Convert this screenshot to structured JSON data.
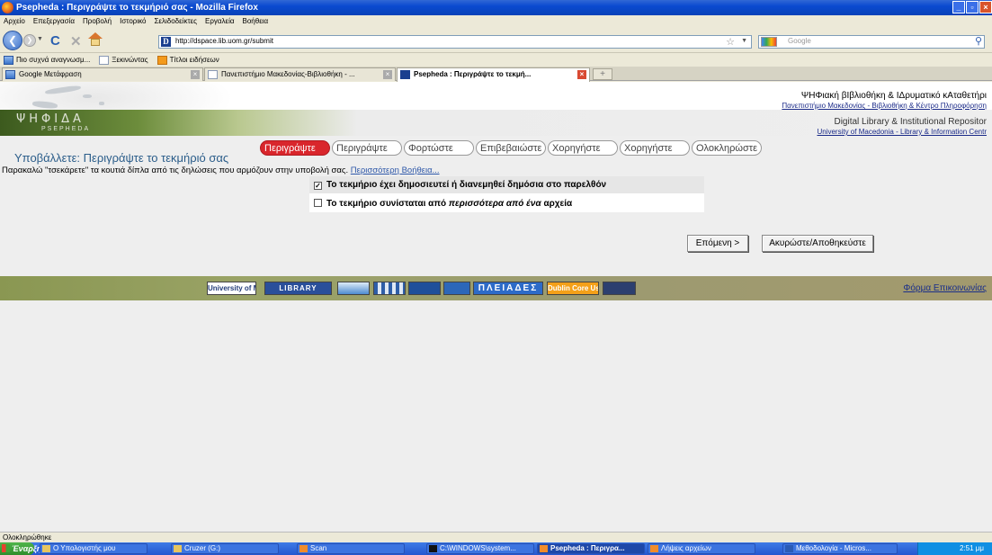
{
  "window": {
    "title": "Psepheda : Περιγράψτε το τεκμήριό σας - Mozilla Firefox",
    "controls": [
      "_",
      "▫",
      "×"
    ]
  },
  "menubar": [
    "Αρχείο",
    "Επεξεργασία",
    "Προβολή",
    "Ιστορικό",
    "Σελιδοδείκτες",
    "Εργαλεία",
    "Βοήθεια"
  ],
  "navbar": {
    "url": "http://dspace.lib.uom.gr/submit",
    "search_placeholder": "Google"
  },
  "bookmarks": [
    "Πιο συχνά αναγνωσμ...",
    "Ξεκινώντας",
    "Τίτλοι ειδήσεων"
  ],
  "tabs": [
    {
      "label": "Google Μετάφραση"
    },
    {
      "label": "Πανεπιστήμιο Μακεδονίας-Βιβλιοθήκη - ..."
    },
    {
      "label": "Psepheda : Περιγράψτε το τεκμή..."
    }
  ],
  "header": {
    "site_title": "ΨΗΦιακή βΙβλιοθήκη & ΙΔρυματικό κΑταθετήρι",
    "site_subtitle": "Πανεπιστήμιο Μακεδονίας - Βιβλιοθήκη & Κέντρο Πληροφόρηση",
    "logo_word": "ΨΗΦΙΔΑ",
    "logo_sub": "PSEPHEDA",
    "dl_title": "Digital Library & Institutional Repositor",
    "dl_subtitle": "University of Macedonia - Library & Information Centr"
  },
  "steps": [
    {
      "label": "Περιγράψτε",
      "current": true
    },
    {
      "label": "Περιγράψτε",
      "current": false
    },
    {
      "label": "Φορτώστε",
      "current": false
    },
    {
      "label": "Επιβεβαιώστε",
      "current": false
    },
    {
      "label": "Χορηγήστε",
      "current": false
    },
    {
      "label": "Χορηγήστε",
      "current": false
    },
    {
      "label": "Ολοκληρώστε",
      "current": false
    }
  ],
  "main": {
    "heading": "Υποβάλλετε: Περιγράψτε το τεκμήριό σας",
    "help_text": "Παρακαλώ \"τσεκάρετε\" τα κουτιά δίπλα από τις δηλώσεις που αρμόζουν στην υποβολή σας.",
    "help_link": "Περισσότερη Βοήθεια...",
    "questions": [
      {
        "text": "Το τεκμήριο έχει δημοσιευτεί ή διανεμηθεί δημόσια στο παρελθόν",
        "checked": true
      },
      {
        "text_prefix": "Το τεκμήριο συνίσταται από",
        "text_emphasis": "περισσότερα από ένα",
        "text_suffix": "αρχεία",
        "checked": false
      }
    ],
    "next_button": "Επόμενη >",
    "cancel_button": "Ακυρώστε/Αποθηκεύστε"
  },
  "footer": {
    "logos": [
      "University of Macedonia",
      "LIBRARY",
      "",
      "",
      "",
      "",
      "ΠΛΕΙΑΔΕΣ",
      "Dublin Core Used Here",
      ""
    ],
    "contact_link": "Φόρμα Επικοινωνίας"
  },
  "statusbar": {
    "text": "Ολοκληρώθηκε"
  },
  "taskbar": {
    "start": "Έναρξη",
    "items": [
      {
        "label": "Ο Υπολογιστής μου",
        "active": false
      },
      {
        "label": "Cruzer (G:)",
        "active": false
      },
      {
        "label": "Scan",
        "active": false
      },
      {
        "label": "C:\\WINDOWS\\system...",
        "active": false
      },
      {
        "label": "Psepheda : Περιγρα...",
        "active": true
      },
      {
        "label": "Λήψεις αρχείων",
        "active": false
      },
      {
        "label": "Μεθοδολογία - Micros...",
        "active": false
      }
    ],
    "clock": "2:51 μμ"
  }
}
